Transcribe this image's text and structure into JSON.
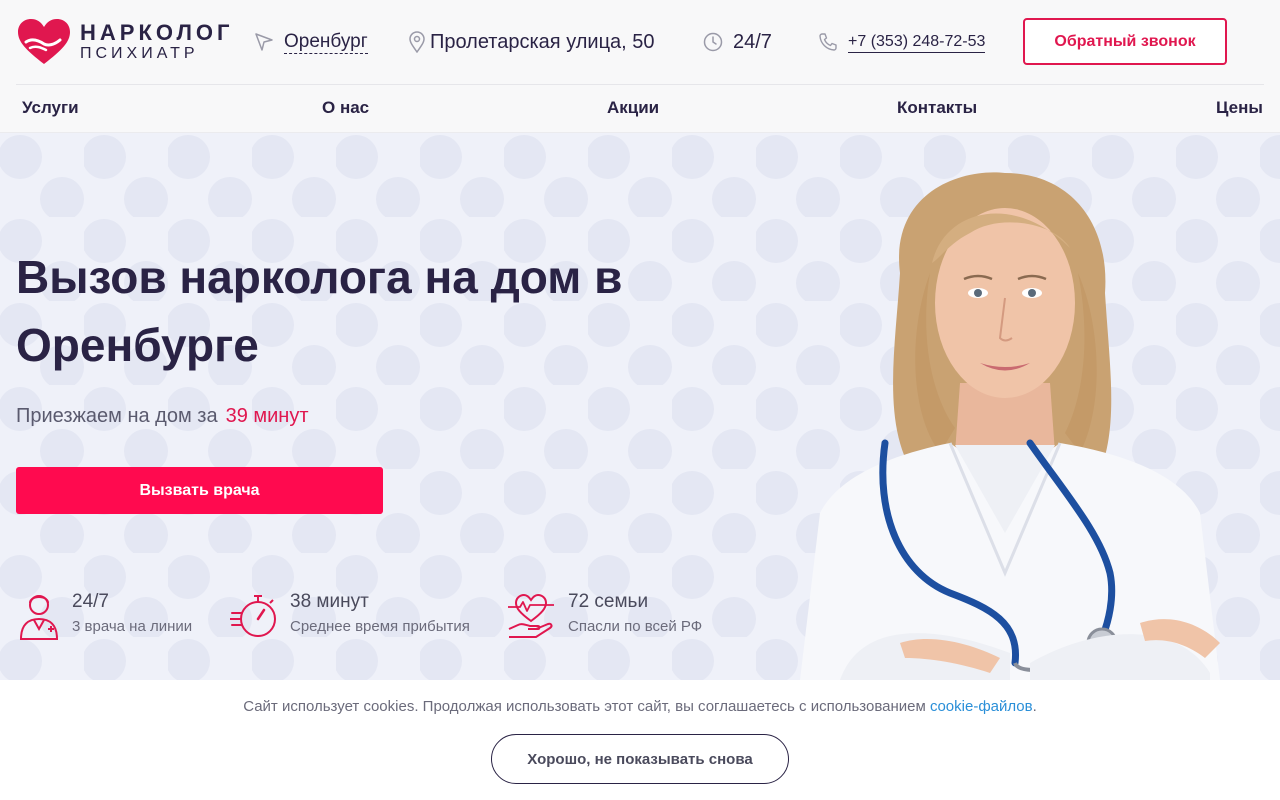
{
  "header": {
    "logo": {
      "line1": "НАРКОЛОГ",
      "line2": "ПСИХИАТР"
    },
    "city": "Оренбург",
    "address": "Пролетарская улица, 50",
    "hours": "24/7",
    "phone": "+7 (353) 248-72-53",
    "callback_label": "Обратный звонок"
  },
  "nav": {
    "items": [
      {
        "label": "Услуги"
      },
      {
        "label": "О нас"
      },
      {
        "label": "Акции"
      },
      {
        "label": "Контакты"
      },
      {
        "label": "Цены"
      }
    ]
  },
  "hero": {
    "title": "Вызов нарколога на дом в Оренбурге",
    "subtitle_prefix": "Приезжаем на дом за",
    "subtitle_accent": "39 минут",
    "cta_label": "Вызвать врача",
    "stats": [
      {
        "value": "24/7",
        "desc": "3 врача на линии",
        "icon": "doctor-icon"
      },
      {
        "value": "38 минут",
        "desc": "Среднее время прибытия",
        "icon": "stopwatch-icon"
      },
      {
        "value": "72 семьи",
        "desc": "Спасли по всей РФ",
        "icon": "heart-hand-icon"
      }
    ]
  },
  "cookie": {
    "text": "Сайт использует cookies. Продолжая использовать этот сайт, вы соглашаетесь с использованием",
    "link": "cookie-файлов",
    "period": ".",
    "button_label": "Хорошо, не показывать снова"
  },
  "colors": {
    "accent": "#e0174f",
    "cta": "#ff0a4f",
    "text_dark": "#2a2345",
    "hero_bg": "#eff1f9"
  }
}
